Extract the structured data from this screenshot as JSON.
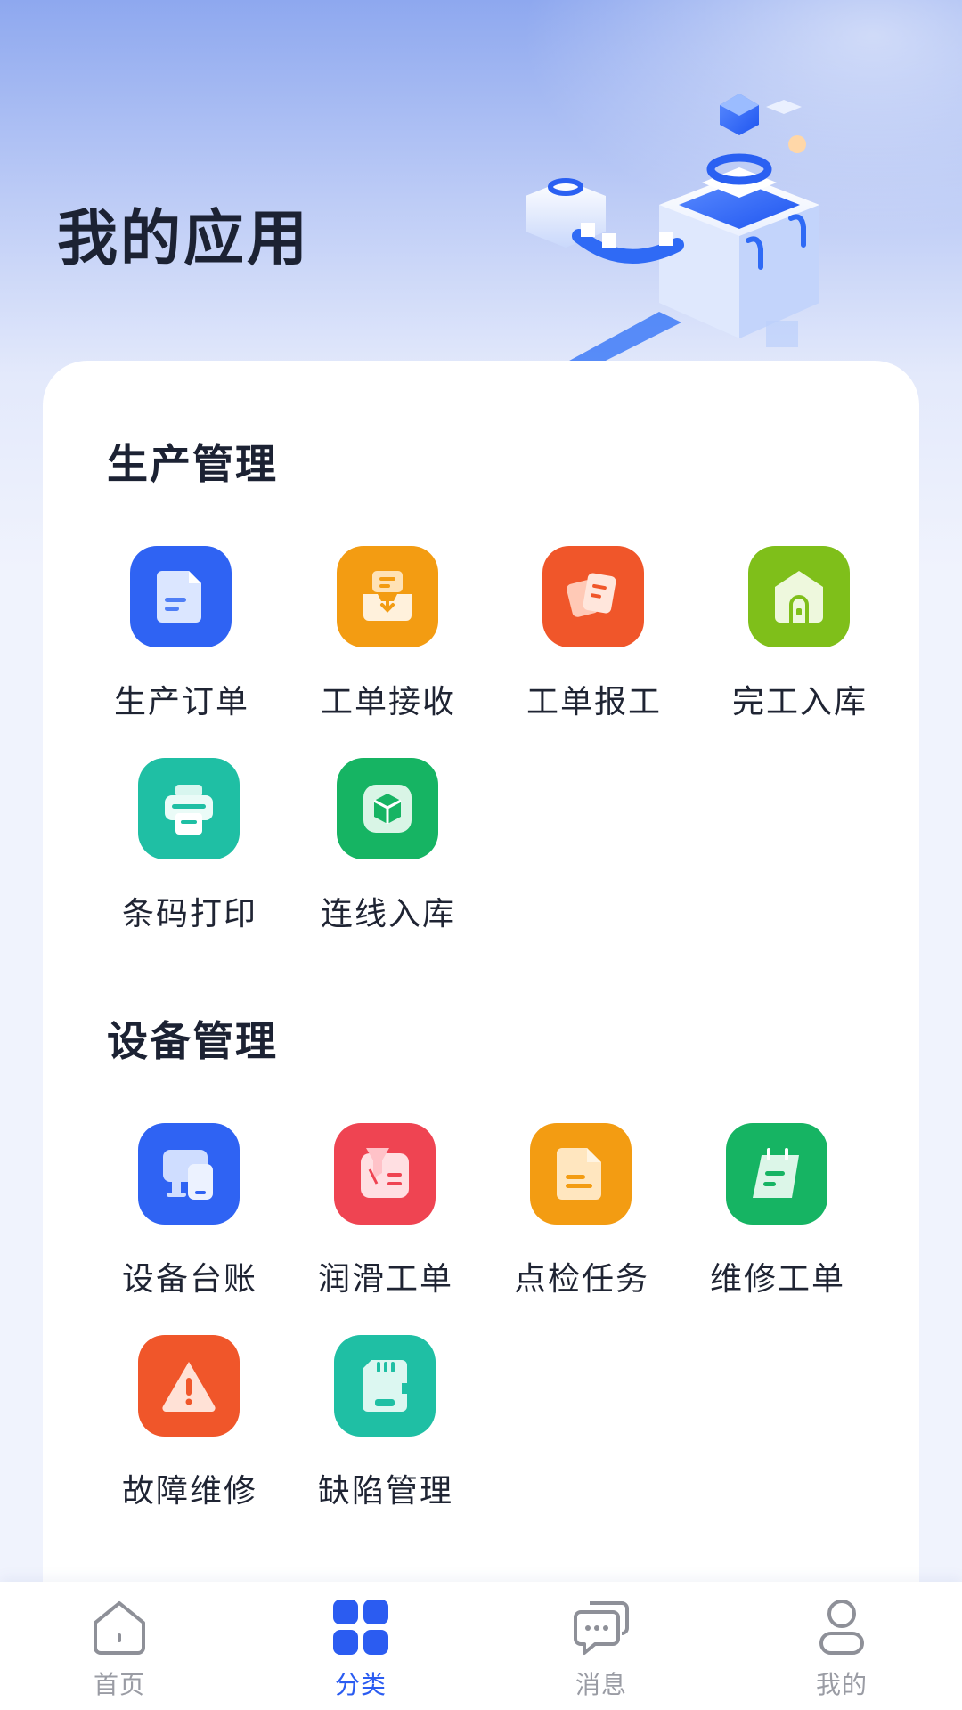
{
  "header": {
    "title": "我的应用"
  },
  "sections": [
    {
      "title": "生产管理",
      "apps": [
        {
          "label": "生产订单",
          "icon": "document-icon",
          "color": "#2f63f3"
        },
        {
          "label": "工单接收",
          "icon": "inbox-download-icon",
          "color": "#f39c12"
        },
        {
          "label": "工单报工",
          "icon": "notes-icon",
          "color": "#f0562a"
        },
        {
          "label": "完工入库",
          "icon": "warehouse-icon",
          "color": "#7fbf1a"
        },
        {
          "label": "条码打印",
          "icon": "printer-icon",
          "color": "#1fbfa4"
        },
        {
          "label": "连线入库",
          "icon": "cube-icon",
          "color": "#16b463"
        }
      ]
    },
    {
      "title": "设备管理",
      "apps": [
        {
          "label": "设备台账",
          "icon": "devices-icon",
          "color": "#2f63f3"
        },
        {
          "label": "润滑工单",
          "icon": "oil-funnel-icon",
          "color": "#ef4452"
        },
        {
          "label": "点检任务",
          "icon": "checklist-icon",
          "color": "#f39c12"
        },
        {
          "label": "维修工单",
          "icon": "calendar-note-icon",
          "color": "#16b463"
        },
        {
          "label": "故障维修",
          "icon": "warning-icon",
          "color": "#f0562a"
        },
        {
          "label": "缺陷管理",
          "icon": "sd-card-icon",
          "color": "#1fbfa4"
        }
      ]
    }
  ],
  "tabbar": {
    "active": "分类",
    "active_color": "#2b5cf1",
    "items": [
      {
        "label": "首页",
        "icon": "home-icon"
      },
      {
        "label": "分类",
        "icon": "grid-icon"
      },
      {
        "label": "消息",
        "icon": "chat-icon"
      },
      {
        "label": "我的",
        "icon": "user-icon"
      }
    ]
  }
}
